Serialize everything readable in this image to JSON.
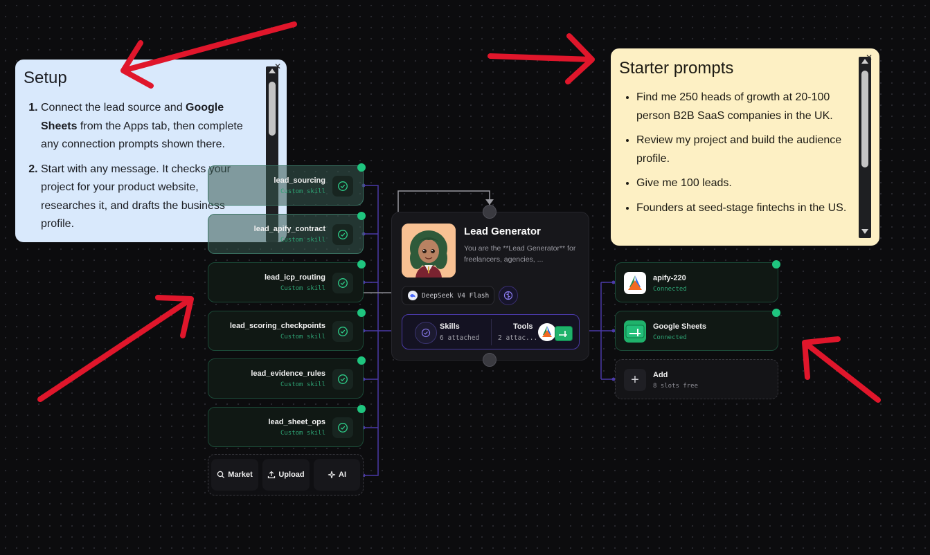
{
  "setup_note": {
    "title": "Setup",
    "step1_pre": "Connect the lead source and ",
    "step1_bold": "Google Sheets",
    "step1_post": " from the Apps tab, then complete any connection prompts shown there.",
    "step2": "Start with any message. It checks your project for your product website, researches it, and drafts the business profile."
  },
  "starter_note": {
    "title": "Starter prompts",
    "prompts": [
      "Find me 250 heads of growth at 20-100 person B2B SaaS companies in the UK.",
      "Review my project and build the audience profile.",
      "Give me 100 leads.",
      "Founders at seed-stage fintechs in the US."
    ]
  },
  "skills": [
    {
      "name": "lead_sourcing",
      "sub": "Custom skill"
    },
    {
      "name": "lead_apify_contract",
      "sub": "Custom skill"
    },
    {
      "name": "lead_icp_routing",
      "sub": "Custom skill"
    },
    {
      "name": "lead_scoring_checkpoints",
      "sub": "Custom skill"
    },
    {
      "name": "lead_evidence_rules",
      "sub": "Custom skill"
    },
    {
      "name": "lead_sheet_ops",
      "sub": "Custom skill"
    }
  ],
  "actions": {
    "market": "Market",
    "upload": "Upload",
    "ai": "AI"
  },
  "agent": {
    "title": "Lead Generator",
    "description": "You are the **Lead Generator** for freelancers, agencies, ...",
    "model": "DeepSeek V4 Flash",
    "skills_label": "Skills",
    "skills_count": "6 attached",
    "tools_label": "Tools",
    "tools_count": "2 attac..."
  },
  "tools": [
    {
      "name": "apify-220",
      "status": "Connected"
    },
    {
      "name": "Google Sheets",
      "status": "Connected"
    }
  ],
  "add_tool": {
    "label": "Add",
    "sub": "8 slots free"
  },
  "colors": {
    "accent_green": "#1fc57f",
    "accent_purple": "#5b45d6",
    "annotation_red": "#e0162b",
    "setup_bg": "#d9e9fc",
    "starter_bg": "#fdf0c4"
  }
}
